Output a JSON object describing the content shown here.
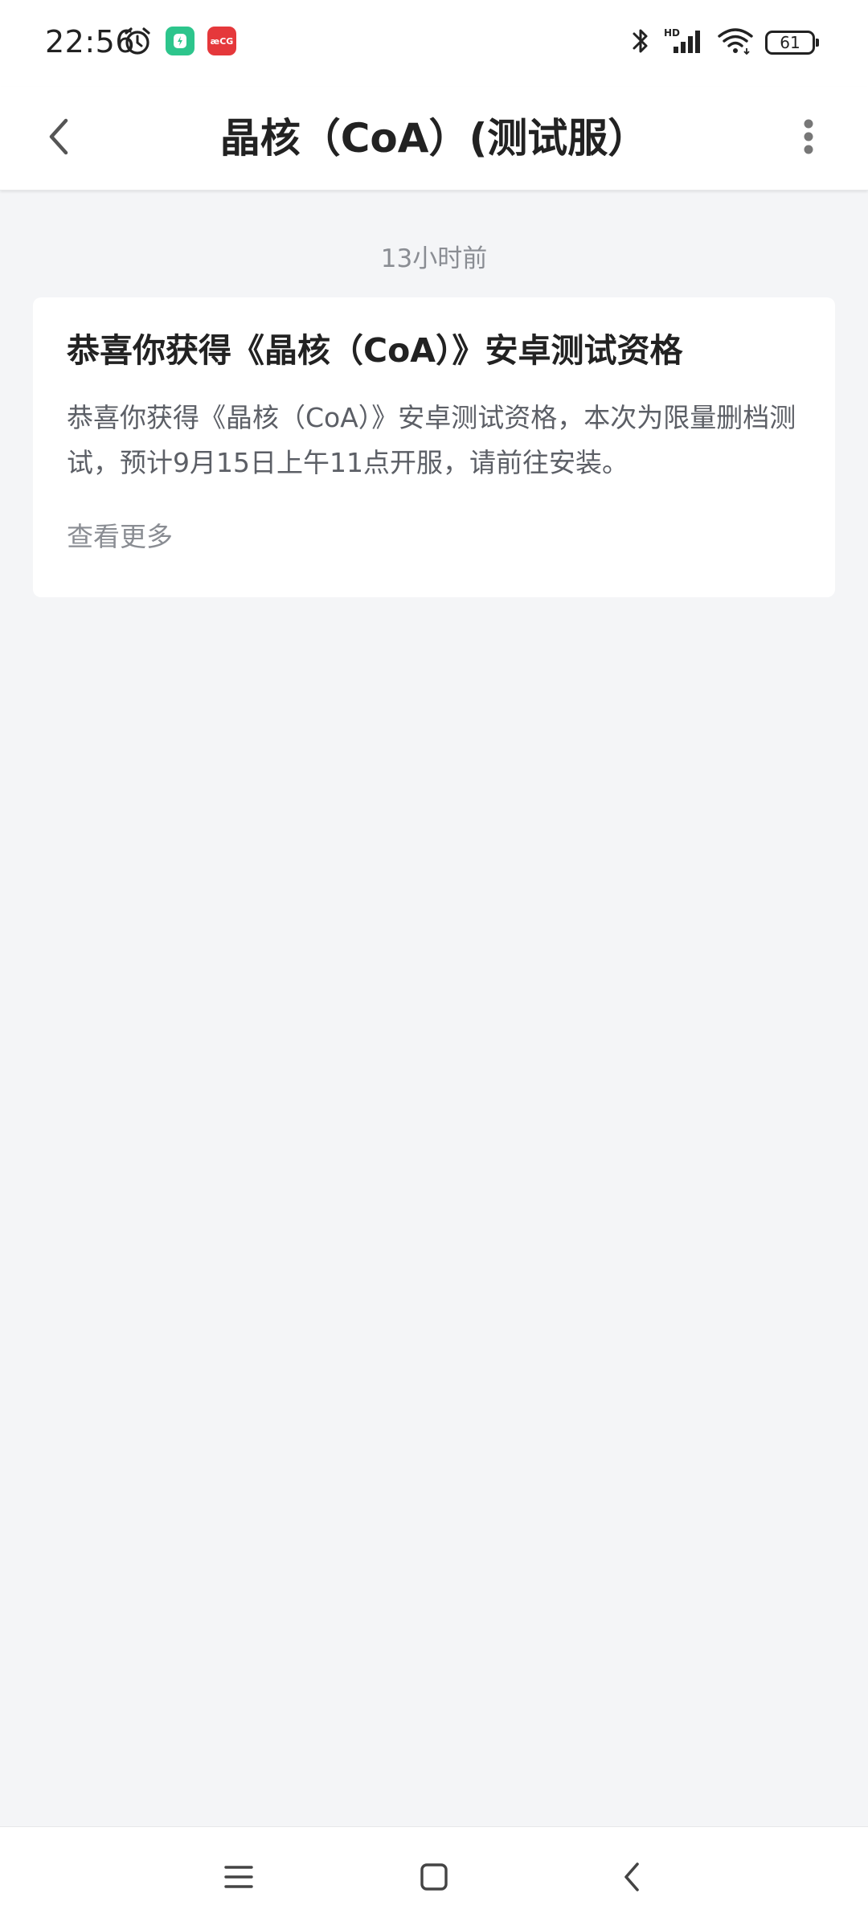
{
  "status_bar": {
    "time": "22:56",
    "battery_level": "61",
    "app_badge_red_text": "æCG",
    "icons": [
      "alarm-icon",
      "app-badge-green-icon",
      "app-badge-red-icon",
      "bluetooth-icon",
      "signal-hd-icon",
      "wifi-icon",
      "battery-icon"
    ]
  },
  "header": {
    "title": "晶核（CoA）(测试服）",
    "back_icon": "chevron-left-icon",
    "more_icon": "more-vertical-icon"
  },
  "messages": [
    {
      "timestamp": "13小时前",
      "title": "恭喜你获得《晶核（CoA）》安卓测试资格",
      "body": "恭喜你获得《晶核（CoA）》安卓测试资格，本次为限量删档测试，预计9月15日上午11点开服，请前往安装。",
      "view_more_label": "查看更多"
    }
  ],
  "nav_bar": {
    "icons": [
      "menu-icon",
      "home-square-icon",
      "back-chevron-icon"
    ]
  },
  "colors": {
    "background": "#f4f5f7",
    "card": "#ffffff",
    "text_primary": "#222222",
    "text_secondary": "#5c5f66",
    "text_muted": "#8a8d93"
  }
}
